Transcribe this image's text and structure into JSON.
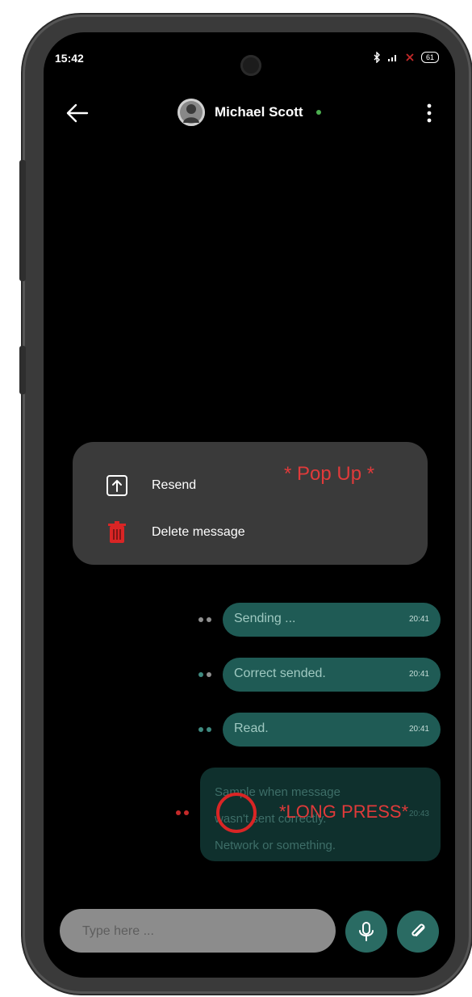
{
  "status_bar": {
    "time": "15:42",
    "battery": "61"
  },
  "header": {
    "contact_name": "Michael Scott",
    "online_color": "#4caf50",
    "back_icon": "arrow-left-icon",
    "menu_icon": "more-vertical-icon"
  },
  "popup": {
    "note": "* Pop Up *",
    "items": [
      {
        "label": "Resend",
        "icon": "upload-icon"
      },
      {
        "label": "Delete message",
        "icon": "trash-icon"
      }
    ]
  },
  "messages": [
    {
      "text": "Sending ...",
      "time": "20:41",
      "status": "sending"
    },
    {
      "text": "Correct sended.",
      "time": "20:41",
      "status": "sent"
    },
    {
      "text": "Read.",
      "time": "20:41",
      "status": "read"
    }
  ],
  "failed_message": {
    "text": "Sample when message\nwasn't sent correctly.\nNetwork or something.",
    "time": "20:43",
    "note": "*LONG PRESS*"
  },
  "composer": {
    "placeholder": "Type here ...",
    "mic_icon": "microphone-icon",
    "attach_icon": "paperclip-icon"
  },
  "colors": {
    "bubble": "#1f5b55",
    "accent_red": "#e03a3a",
    "popup_bg": "#3a3a3a"
  }
}
